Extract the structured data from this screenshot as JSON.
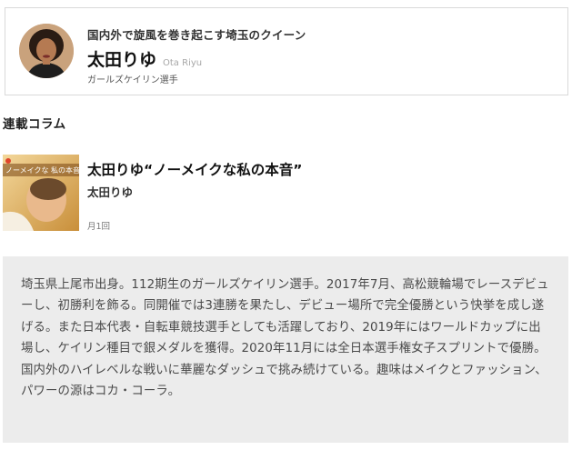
{
  "profile": {
    "tagline": "国内外で旋風を巻き起こす埼玉のクイーン",
    "name_jp": "太田りゆ",
    "name_en": "Ota Riyu",
    "role": "ガールズケイリン選手",
    "avatar_icon": "person-photo-icon"
  },
  "columns": {
    "heading": "連載コラム",
    "items": [
      {
        "title": "太田りゆ“ノーメイクな私の本音”",
        "author": "太田りゆ",
        "frequency": "月1回",
        "thumbnail_text": "ノーメイクな 私の本音"
      }
    ]
  },
  "bio": {
    "text": "埼玉県上尾市出身。112期生のガールズケイリン選手。2017年7月、高松競輪場でレースデビューし、初勝利を飾る。同開催では3連勝を果たし、デビュー場所で完全優勝という快挙を成し遂げる。また日本代表・自転車競技選手としても活躍しており、2019年にはワールドカップに出場し、ケイリン種目で銀メダルを獲得。2020年11月には全日本選手権女子スプリントで優勝。国内外のハイレベルな戦いに華麗なダッシュで挑み続けている。趣味はメイクとファッション、パワーの源はコカ・コーラ。"
  }
}
